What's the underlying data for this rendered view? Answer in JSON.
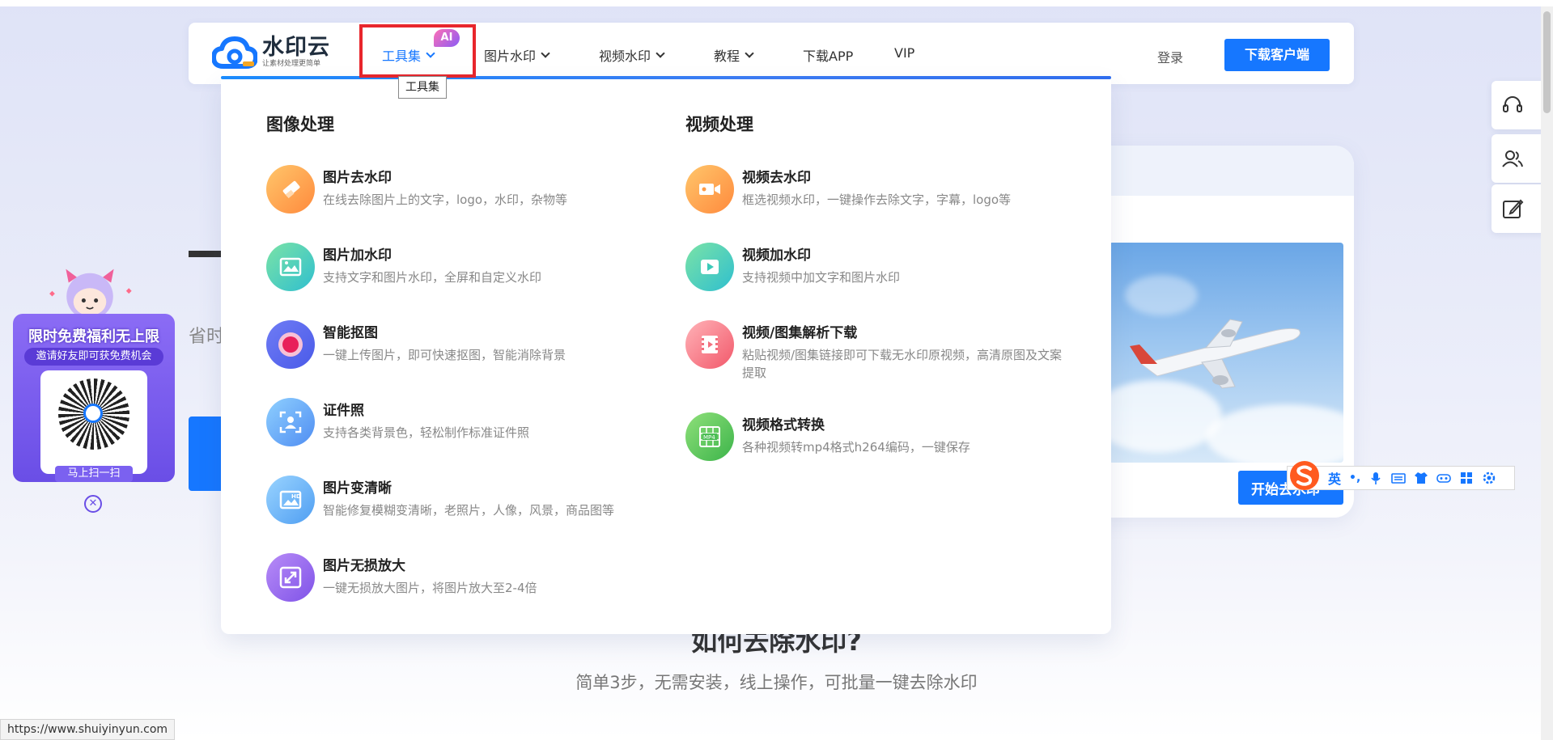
{
  "brand": {
    "name": "水印云",
    "slogan": "让素材处理更简单",
    "accent": "#1677ff",
    "highlight": "#e8262c"
  },
  "nav": {
    "items": [
      {
        "label": "工具集",
        "active": true
      },
      {
        "label": "图片水印"
      },
      {
        "label": "视频水印"
      },
      {
        "label": "教程"
      },
      {
        "label": "下载APP"
      },
      {
        "label": "VIP"
      }
    ],
    "ai_badge": "AI",
    "tooltip": "工具集",
    "login": "登录",
    "download": "下载客户端"
  },
  "dropdown": {
    "image_col": {
      "title": "图像处理",
      "tools": [
        {
          "name": "图片去水印",
          "desc": "在线去除图片上的文字，logo，水印，杂物等",
          "icon": "eraser-icon"
        },
        {
          "name": "图片加水印",
          "desc": "支持文字和图片水印，全屏和自定义水印",
          "icon": "image-icon"
        },
        {
          "name": "智能抠图",
          "desc": "一键上传图片，即可快速抠图，智能消除背景",
          "icon": "cutout-icon"
        },
        {
          "name": "证件照",
          "desc": "支持各类背景色，轻松制作标准证件照",
          "icon": "id-photo-icon"
        },
        {
          "name": "图片变清晰",
          "desc": "智能修复模糊变清晰，老照片，人像，风景，商品图等",
          "icon": "hd-image-icon"
        },
        {
          "name": "图片无损放大",
          "desc": "一键无损放大图片，将图片放大至2-4倍",
          "icon": "enlarge-icon"
        }
      ]
    },
    "video_col": {
      "title": "视频处理",
      "tools": [
        {
          "name": "视频去水印",
          "desc": "框选视频水印，一键操作去除文字，字幕，logo等",
          "icon": "video-camera-icon"
        },
        {
          "name": "视频加水印",
          "desc": "支持视频中加文字和图片水印",
          "icon": "play-icon"
        },
        {
          "name": "视频/图集解析下载",
          "desc": "粘贴视频/图集链接即可下载无水印原视频，高清原图及文案提取",
          "icon": "film-icon"
        },
        {
          "name": "视频格式转换",
          "desc": "各种视频转mp4格式h264编码，一键保存",
          "icon": "mp4-icon"
        }
      ]
    }
  },
  "hero": {
    "sub_partial": "省时",
    "start_button": "开始去水印"
  },
  "how_section": {
    "title": "如何去除水印?",
    "subtitle": "简单3步，无需安装，线上操作，可批量一键去除水印"
  },
  "promo": {
    "title": "限时免费福利无上限",
    "subtitle": "邀请好友即可获免费机会",
    "scan": "马上扫一扫"
  },
  "ime": {
    "lang": "英",
    "punct": "•,"
  },
  "status_url": "https://www.shuiyinyun.com"
}
